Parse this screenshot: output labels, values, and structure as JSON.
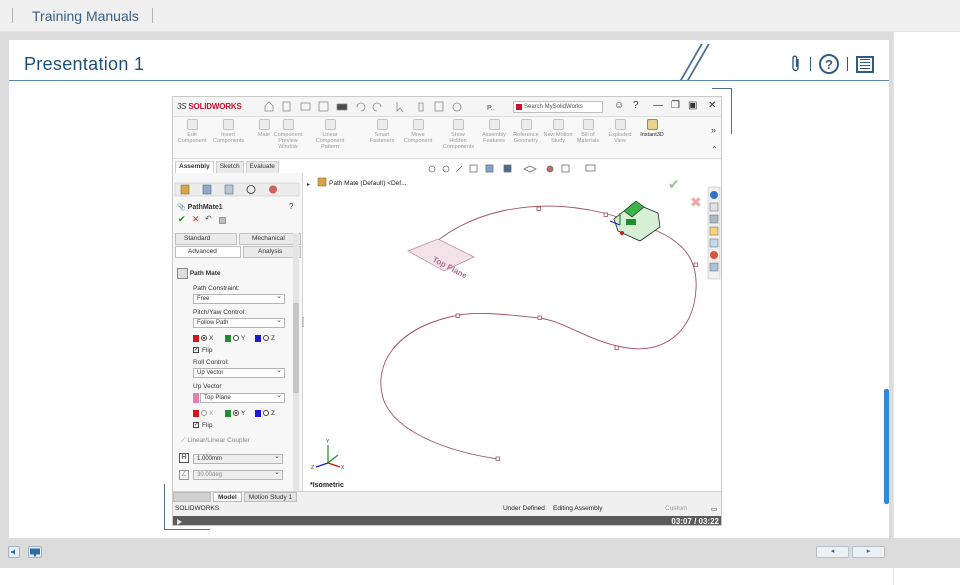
{
  "header": {
    "title": "Training Manuals"
  },
  "slide": {
    "title": "Presentation 1"
  },
  "solidworks": {
    "logo_prefix": "3S",
    "logo_brand": "SOLIDWORKS",
    "title_caption": "P..",
    "search_placeholder": "Search MySolidWorks",
    "ribbon": [
      {
        "label": "Edit Component"
      },
      {
        "label": "Insert Components"
      },
      {
        "label": "Mate"
      },
      {
        "label": "Component Preview Window"
      },
      {
        "label": "Linear Component Pattern"
      },
      {
        "label": "Smart Fasteners"
      },
      {
        "label": "Move Component"
      },
      {
        "label": "Show Hidden Components"
      },
      {
        "label": "Assembly Features"
      },
      {
        "label": "Reference Geometry"
      },
      {
        "label": "New Motion Study"
      },
      {
        "label": "Bill of Materials"
      },
      {
        "label": "Exploded View"
      },
      {
        "label": "Instant3D"
      }
    ],
    "tabs": [
      "Assembly",
      "Sketch",
      "Evaluate"
    ],
    "property": {
      "name": "PathMate1",
      "mate_tabs": {
        "standard": "Standard",
        "mechanical": "Mechanical",
        "advanced": "Advanced",
        "analysis": "Analysis"
      },
      "section": "Path Mate",
      "path_constraint_label": "Path Constraint:",
      "path_constraint_value": "Free",
      "pitch_label": "Pitch/Yaw Control:",
      "pitch_value": "Follow Path",
      "axis_x": "X",
      "axis_y": "Y",
      "axis_z": "Z",
      "flip": "Flip",
      "roll_label": "Roll Control:",
      "roll_value": "Up Vector",
      "up_vector_label": "Up Vector",
      "up_vector_value": "Top Plane",
      "coupler": "Linear/Linear Coupler",
      "distance": "1.000mm",
      "angle": "30.00deg"
    },
    "tree_item": "Path Mate (Default) <Def...",
    "plane_label": "Top Plane",
    "view_label": "*Isometric",
    "triad": {
      "x": "X",
      "y": "Y",
      "z": "Z"
    },
    "model_tabs": [
      "Model",
      "Motion Study 1"
    ],
    "status": {
      "app": "SOLIDWORKS",
      "state": "Under Defined",
      "mode": "Editing Assembly",
      "units": "Custom"
    },
    "video_time": "03:07 / 03:22"
  },
  "colors": {
    "accent": "#1c4f78",
    "brand": "#c8102e",
    "curve": "#a05060",
    "scroll": "#2e8bd8"
  }
}
